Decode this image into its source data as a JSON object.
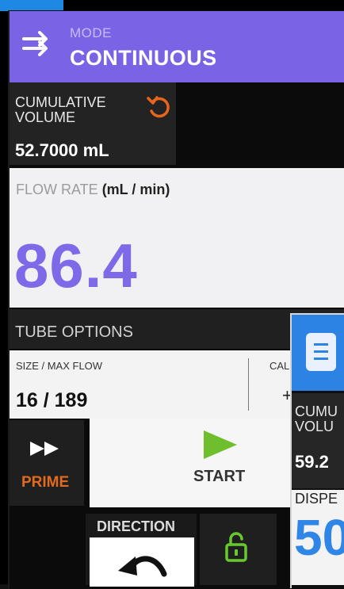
{
  "mode": {
    "label": "MODE",
    "value": "CONTINUOUS",
    "icon": "arrow-right-double-icon"
  },
  "cumulative": {
    "label": "CUMULATIVE VOLUME",
    "value": "52.7000 mL",
    "reset_icon": "reset-icon"
  },
  "flow": {
    "label": "FLOW RATE",
    "unit": "(mL / min)",
    "value": "86.4"
  },
  "tube": {
    "title": "TUBE OPTIONS",
    "size_label": "SIZE / MAX FLOW",
    "size_value": "16 / 189",
    "cal_label": "CAL",
    "cal_symbol": "+"
  },
  "prime": {
    "label": "PRIME",
    "icon": "fast-forward-icon"
  },
  "start": {
    "label": "START",
    "icon": "play-icon"
  },
  "direction": {
    "label": "DIRECTION",
    "icon": "rotate-ccw-icon"
  },
  "lock": {
    "icon": "unlock-icon"
  },
  "overlay": {
    "cum_label": "CUMU\nVOLU",
    "cum_value": "59.2",
    "disp_label": "DISPE",
    "disp_value": "50",
    "icon": "document-icon"
  },
  "colors": {
    "mode_bar": "#7b63e6",
    "flow_value": "#7e6ae8",
    "prime": "#e06a1e",
    "start_green": "#6fbe2e",
    "lock_green": "#68c92e",
    "overlay_blue": "#2c83e3"
  }
}
